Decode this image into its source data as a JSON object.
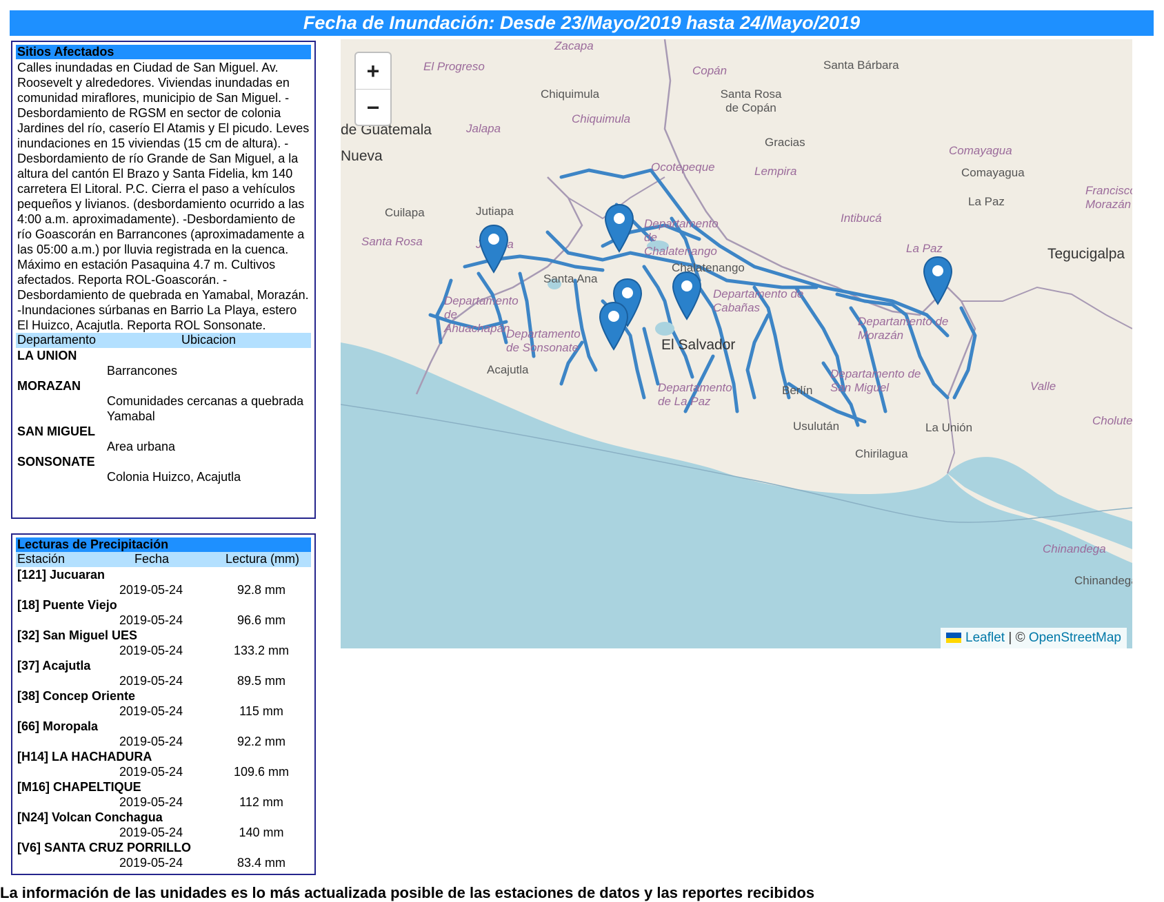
{
  "header": {
    "title": "Fecha de Inundación: Desde 23/Mayo/2019 hasta 24/Mayo/2019"
  },
  "sitios": {
    "heading": "Sitios Afectados",
    "description": "Calles inundadas en Ciudad de San Miguel. Av. Roosevelt y alrededores. Viviendas inundadas en comunidad miraflores, municipio de San Miguel. -Desbordamiento de RGSM en sector de colonia Jardines del río, caserío El Atamis y El picudo. Leves inundaciones en 15 viviendas (15 cm de altura). -Desbordamiento de río Grande de San Miguel, a la altura del cantón El Brazo y Santa Fidelia, km 140 carretera El Litoral. P.C. Cierra el paso a vehículos pequeños y livianos. (desbordamiento ocurrido a las 4:00 a.m. aproximadamente). -Desbordamiento de río Goascorán en Barrancones (aproximadamente a las 05:00 a.m.) por lluvia registrada en la cuenca. Máximo en estación Pasaquina 4.7 m. Cultivos afectados. Reporta ROL-Goascorán. -Desbordamiento de quebrada en Yamabal, Morazán. -Inundaciones súrbanas en Barrio La Playa, estero El Huizco, Acajutla. Reporta ROL Sonsonate.",
    "col_departamento": "Departamento",
    "col_ubicacion": "Ubicacion",
    "rows": [
      {
        "departamento": "LA UNION",
        "ubicacion": "Barrancones"
      },
      {
        "departamento": "MORAZAN",
        "ubicacion": "Comunidades cercanas a quebrada Yamabal"
      },
      {
        "departamento": "SAN MIGUEL",
        "ubicacion": "Area urbana"
      },
      {
        "departamento": "SONSONATE",
        "ubicacion": "Colonia Huizco, Acajutla"
      }
    ]
  },
  "lecturas": {
    "heading": "Lecturas de Precipitación",
    "col_estacion": "Estación",
    "col_fecha": "Fecha",
    "col_lectura": "Lectura (mm)",
    "stations": [
      {
        "name": "[121] Jucuaran",
        "fecha": "2019-05-24",
        "lectura": "92.8 mm"
      },
      {
        "name": "[18] Puente Viejo",
        "fecha": "2019-05-24",
        "lectura": "96.6 mm"
      },
      {
        "name": "[32] San Miguel UES",
        "fecha": "2019-05-24",
        "lectura": "133.2 mm"
      },
      {
        "name": "[37] Acajutla",
        "fecha": "2019-05-24",
        "lectura": "89.5 mm"
      },
      {
        "name": "[38] Concep Oriente",
        "fecha": "2019-05-24",
        "lectura": "115 mm"
      },
      {
        "name": "[66] Moropala",
        "fecha": "2019-05-24",
        "lectura": "92.2 mm"
      },
      {
        "name": "[H14] LA HACHADURA",
        "fecha": "2019-05-24",
        "lectura": "109.6 mm"
      },
      {
        "name": "[M16] CHAPELTIQUE",
        "fecha": "2019-05-24",
        "lectura": "112 mm"
      },
      {
        "name": "[N24] Volcan Conchagua",
        "fecha": "2019-05-24",
        "lectura": "140 mm"
      },
      {
        "name": "[V6] SANTA CRUZ PORRILLO",
        "fecha": "2019-05-24",
        "lectura": "83.4 mm"
      }
    ]
  },
  "map": {
    "zoom_in": "+",
    "zoom_out": "−",
    "attribution_leaflet": "Leaflet",
    "attribution_sep": "| ©",
    "attribution_osm": "OpenStreetMap",
    "marker_count": 6,
    "colors": {
      "water": "#aad3df",
      "land": "#f1ede4",
      "rivers": "#3d85c6",
      "marker": "#2a81cb"
    },
    "labels": {
      "zacapa": "Zacapa",
      "el_progreso": "El Progreso",
      "copan_dep": "Copán",
      "santa_barbara": "Santa Bárbara",
      "chiquimula": "Chiquimula",
      "santa_rosa_copan": "Santa Rosa de Copán",
      "chiquimula_dep": "Chiquimula",
      "guatemala": "de Guatemala",
      "jalapa": "Jalapa",
      "gracias": "Gracias",
      "comayagua_dep": "Comayagua",
      "nueva": "Nueva",
      "ocotepeque": "Ocotepeque",
      "lempira": "Lempira",
      "comayagua": "Comayagua",
      "francisco": "Francisco Morazán",
      "la_paz": "La Paz",
      "cuilapa": "Cuilapa",
      "jutiapa": "Jutiapa",
      "intibuca": "Intibucá",
      "santa_rosa": "Santa Rosa",
      "jutiapa_dep": "Jutiapa",
      "chalatenango": "Departamento de Chalatenango",
      "la_paz_dep": "La Paz",
      "tegucigalpa": "Tegucigalpa",
      "chalatenango_city": "Chalatenango",
      "santa_ana": "Santa Ana",
      "cabanas": "Departamento de Cabañas",
      "ahuachapan": "Departamento de Ahuachapán",
      "morazan": "Departamento de Morazán",
      "sonsonate": "Departamento de Sonsonate",
      "el_salvador": "El Salvador",
      "acajutla": "Acajutla",
      "san_miguel": "Departamento de San Miguel",
      "valle": "Valle",
      "la_paz_sv": "Departamento de La Paz",
      "berlin": "Berlín",
      "usulutan": "Usulután",
      "la_union": "La Unión",
      "choluteca": "Choluteca",
      "chirilagua": "Chirilagua",
      "chinandega_dep": "Chinandega",
      "chinandega": "Chinandega"
    }
  },
  "footer": {
    "text": "La información de las unidades es lo más actualizada posible de las estaciones de datos y las reportes recibidos"
  }
}
